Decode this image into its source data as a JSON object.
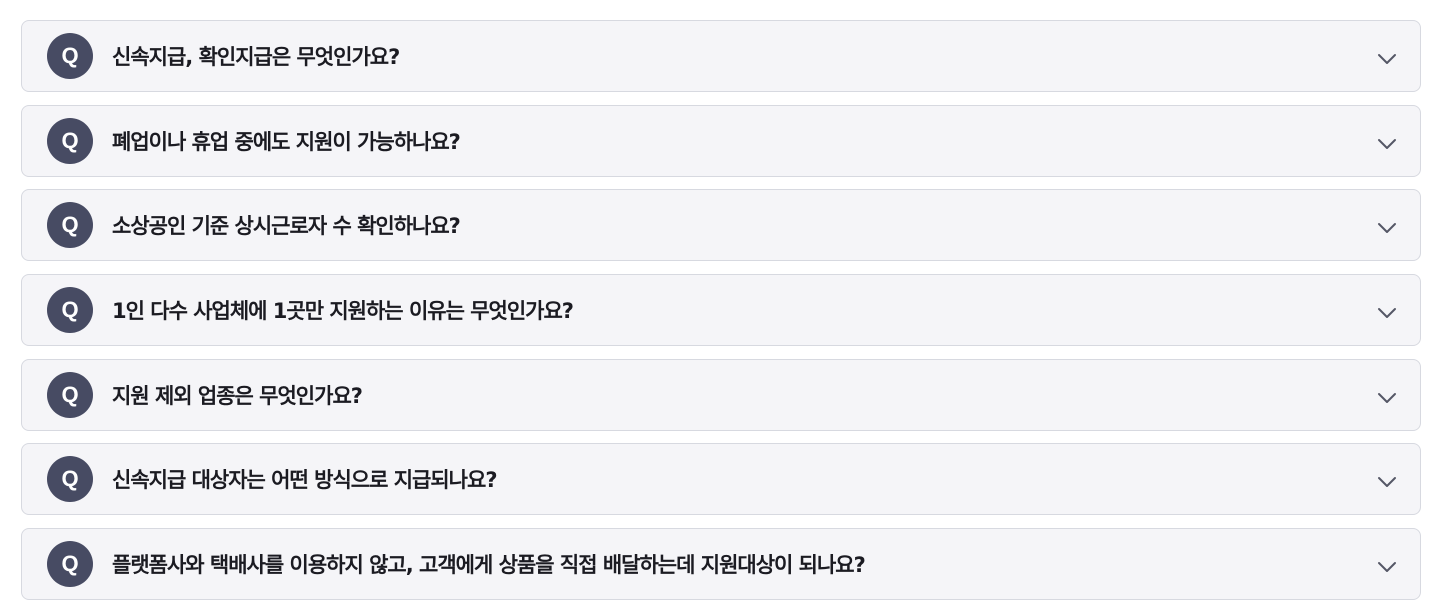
{
  "faq": {
    "badge_label": "Q",
    "toggle_icon": "chevron-down-icon",
    "colors": {
      "badge_bg": "#474b63",
      "item_bg": "#f5f5f8",
      "item_border": "#d7d9e0",
      "question_text": "#1b1b22",
      "chevron": "#555766"
    },
    "items": [
      {
        "question": "신속지급, 확인지급은 무엇인가요?"
      },
      {
        "question": "폐업이나 휴업 중에도 지원이 가능하나요?"
      },
      {
        "question": "소상공인 기준 상시근로자 수 확인하나요?"
      },
      {
        "question": "1인 다수 사업체에 1곳만 지원하는 이유는 무엇인가요?"
      },
      {
        "question": "지원 제외 업종은 무엇인가요?"
      },
      {
        "question": "신속지급 대상자는 어떤 방식으로 지급되나요?"
      },
      {
        "question": "플랫폼사와 택배사를 이용하지 않고, 고객에게 상품을 직접 배달하는데 지원대상이 되나요?"
      }
    ]
  }
}
